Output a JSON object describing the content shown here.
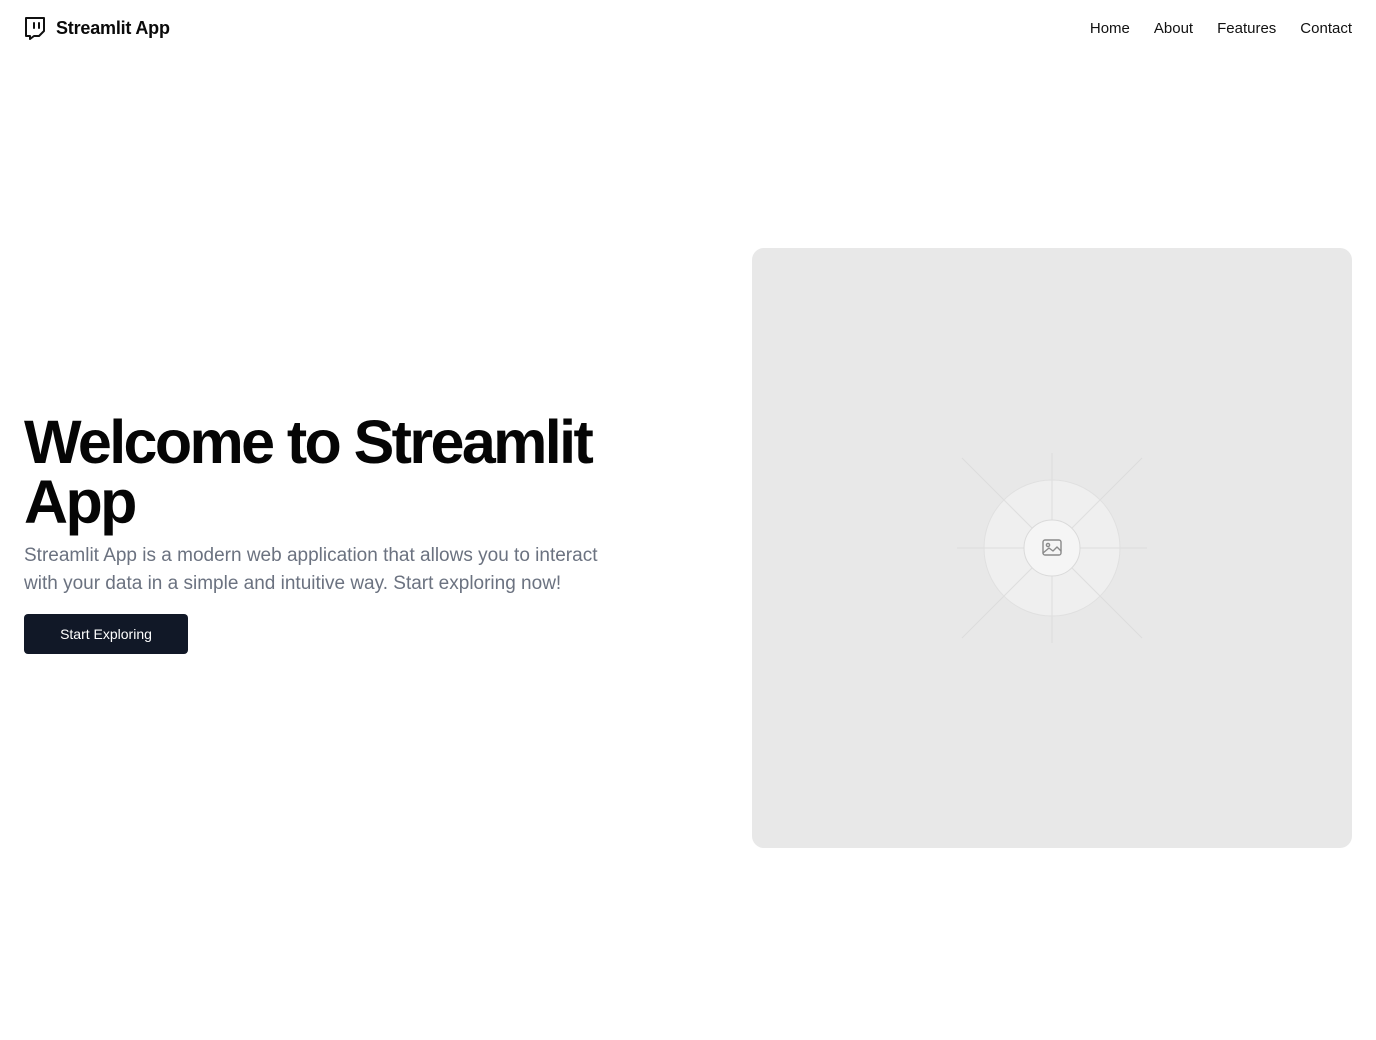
{
  "header": {
    "brand_name": "Streamlit App",
    "brand_icon": "twitch-icon",
    "nav": [
      {
        "label": "Home"
      },
      {
        "label": "About"
      },
      {
        "label": "Features"
      },
      {
        "label": "Contact"
      }
    ]
  },
  "hero": {
    "title": "Welcome to Streamlit App",
    "description": "Streamlit App is a modern web application that allows you to interact with your data in a simple and intuitive way. Start exploring now!",
    "cta_label": "Start Exploring"
  },
  "media": {
    "placeholder_icon": "image-icon"
  },
  "colors": {
    "cta_background": "#111827",
    "description_text": "#6b7280",
    "placeholder_background": "#e8e8e8"
  }
}
